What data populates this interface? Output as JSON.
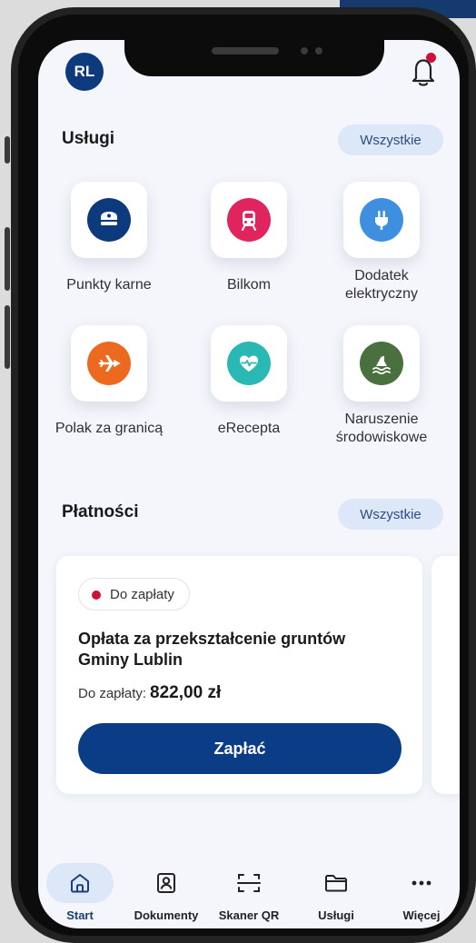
{
  "header": {
    "avatar_initials": "RL"
  },
  "services": {
    "title": "Usługi",
    "all_label": "Wszystkie",
    "items": [
      {
        "label": "Punkty karne",
        "icon": "police-cap-icon",
        "color": "#0d3a7d"
      },
      {
        "label": "Bilkom",
        "icon": "train-icon",
        "color": "#e0245e"
      },
      {
        "label": "Dodatek elektryczny",
        "icon": "plug-icon",
        "color": "#3f8fe0"
      },
      {
        "label": "Polak za granicą",
        "icon": "airplane-icon",
        "color": "#ec6a1f"
      },
      {
        "label": "eRecepta",
        "icon": "heart-pulse-icon",
        "color": "#2ab8b4"
      },
      {
        "label": "Naruszenie środowiskowe",
        "icon": "environment-icon",
        "color": "#4a7040"
      }
    ]
  },
  "payments": {
    "title": "Płatności",
    "all_label": "Wszystkie",
    "card": {
      "status": "Do zapłaty",
      "status_color": "#d0103a",
      "title": "Opłata za przekształcenie gruntów Gminy Lublin",
      "amount_label": "Do zapłaty:",
      "amount": "822,00 zł",
      "pay_label": "Zapłać"
    }
  },
  "nav": {
    "items": [
      {
        "label": "Start",
        "icon": "home-icon",
        "active": true
      },
      {
        "label": "Dokumenty",
        "icon": "id-card-icon",
        "active": false
      },
      {
        "label": "Skaner QR",
        "icon": "qr-scanner-icon",
        "active": false
      },
      {
        "label": "Usługi",
        "icon": "folder-icon",
        "active": false
      },
      {
        "label": "Więcej",
        "icon": "more-icon",
        "active": false
      }
    ]
  },
  "colors": {
    "primary": "#0b3c86",
    "accent_bg": "#dce8f7",
    "alert": "#d0103a"
  }
}
